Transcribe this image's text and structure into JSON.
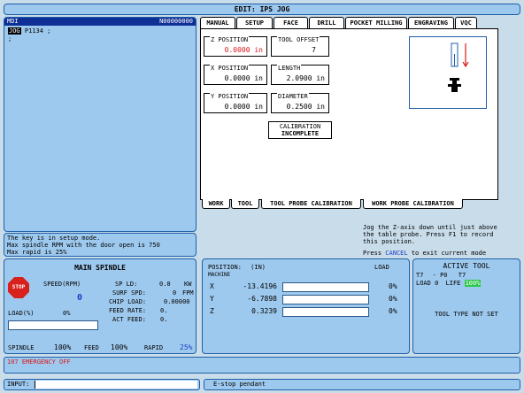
{
  "window": {
    "title": "EDIT: IPS JOG"
  },
  "mdi": {
    "label": "MDI",
    "program_number": "N00000000",
    "tag": "JOG",
    "line1": "P1134 ;",
    "line2": ";"
  },
  "tabs": {
    "top": [
      "MANUAL",
      "SETUP",
      "FACE",
      "DRILL",
      "POCKET MILLING",
      "ENGRAVING",
      "VQC"
    ],
    "active_top": "SETUP",
    "bottom": [
      "WORK",
      "TOOL",
      "TOOL PROBE CALIBRATION",
      "WORK PROBE CALIBRATION"
    ],
    "active_bottom": "TOOL PROBE CALIBRATION"
  },
  "setup": {
    "z_position": {
      "label": "Z POSITION",
      "value": "0.0000 in"
    },
    "tool_offset": {
      "label": "TOOL OFFSET",
      "value": "7"
    },
    "x_position": {
      "label": "X POSITION",
      "value": "0.0000 in"
    },
    "length": {
      "label": "LENGTH",
      "value": "2.0900 in"
    },
    "y_position": {
      "label": "Y POSITION",
      "value": "0.0000 in"
    },
    "diameter": {
      "label": "DIAMETER",
      "value": "0.2500 in"
    },
    "calibration": {
      "label": "CALIBRATION",
      "value": "INCOMPLETE"
    }
  },
  "instructions": {
    "line1": "Jog the Z-axis down until just above",
    "line2": "the table probe. Press F1 to record",
    "line3": "this position.",
    "press": "Press",
    "cancel": "CANCEL",
    "exit": "to exit current mode"
  },
  "messages": {
    "line1": "The key is in setup mode.",
    "line2": "Max spindle RPM with the door open is 750",
    "line3": "Max rapid is 25%"
  },
  "spindle": {
    "title": "MAIN SPINDLE",
    "stop_label": "STOP",
    "speed_label": "SPEED(RPM)",
    "speed_value": "0",
    "load_label": "LOAD(%)",
    "load_value": "0%",
    "sp_ld_label": "SP LD:",
    "sp_ld_value": "0.0",
    "sp_ld_unit": "KW",
    "surf_spd_label": "SURF SPD:",
    "surf_spd_value": "0",
    "surf_spd_unit": "FPM",
    "chip_load_label": "CHIP LOAD:",
    "chip_load_value": "0.00000",
    "feed_rate_label": "FEED RATE:",
    "feed_rate_value": "0.",
    "act_feed_label": "ACT FEED:",
    "act_feed_value": "0.",
    "spindle_label": "SPINDLE",
    "spindle_pct": "100%",
    "feed_label": "FEED",
    "feed_pct": "100%",
    "rapid_label": "RAPID",
    "rapid_pct": "25%"
  },
  "position": {
    "title": "POSITION:",
    "unit": "(IN)",
    "machine": "MACHINE",
    "load_header": "LOAD",
    "axes": [
      {
        "axis": "X",
        "value": "-13.4196",
        "load": "0%"
      },
      {
        "axis": "Y",
        "value": "-6.7898",
        "load": "0%"
      },
      {
        "axis": "Z",
        "value": "0.3239",
        "load": "0%"
      }
    ]
  },
  "active_tool": {
    "title": "ACTIVE TOOL",
    "t_left": "T7",
    "p": "- P0",
    "t_right": "T7",
    "load": "LOAD 0",
    "life_label": "LIFE",
    "life_value": "100%",
    "tool_type": "TOOL TYPE NOT SET"
  },
  "alarm": {
    "text": "107 EMERGENCY OFF"
  },
  "input": {
    "label": "INPUT:",
    "value": ""
  },
  "status": {
    "text": "E-stop pendant"
  },
  "colors": {
    "panel": "#9ec9ee",
    "header": "#0e2f96",
    "alarm_red": "#d81818",
    "accent_blue": "#1a3fc4",
    "life_green": "#2cc84a"
  }
}
